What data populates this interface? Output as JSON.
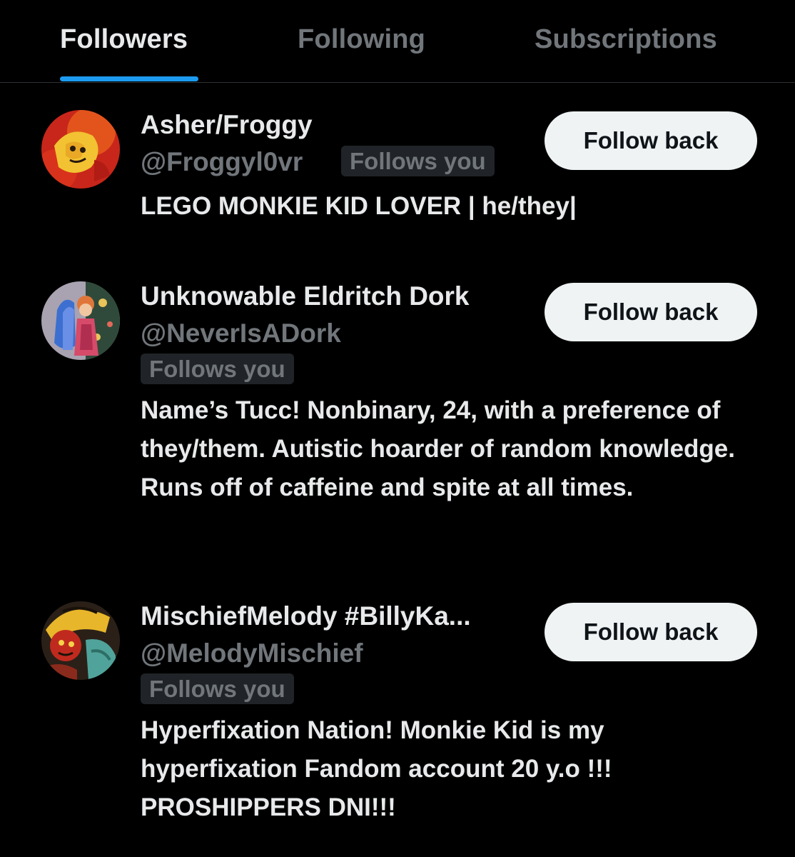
{
  "tabs": [
    {
      "label": "Followers",
      "active": true
    },
    {
      "label": "Following",
      "active": false
    },
    {
      "label": "Subscriptions",
      "active": false
    }
  ],
  "colors": {
    "background": "#000000",
    "accent": "#1d9bf0",
    "text_primary": "#e7e9ea",
    "text_secondary": "#71767b",
    "badge_bg": "#202327",
    "button_bg": "#eff3f4"
  },
  "followers": [
    {
      "name": "Asher/Froggy",
      "handle": "@Froggyl0vr",
      "badge": "Follows you",
      "button": "Follow back",
      "bio": "LEGO MONKIE KID LOVER | he/they|"
    },
    {
      "name": "Unknowable Eldritch Dork",
      "handle": "@NeverIsADork",
      "badge": "Follows you",
      "button": "Follow back",
      "bio": "Name’s Tucc! Nonbinary, 24, with a preference of they/them. Autistic hoarder of random knowledge. Runs off of caffeine and spite at all times."
    },
    {
      "name": "MischiefMelody #BillyKa...",
      "handle": "@MelodyMischief",
      "badge": "Follows you",
      "button": "Follow back",
      "bio": "Hyperfixation Nation! Monkie Kid is my hyperfixation Fandom account 20 y.o !!! PROSHIPPERS DNI!!!"
    }
  ]
}
